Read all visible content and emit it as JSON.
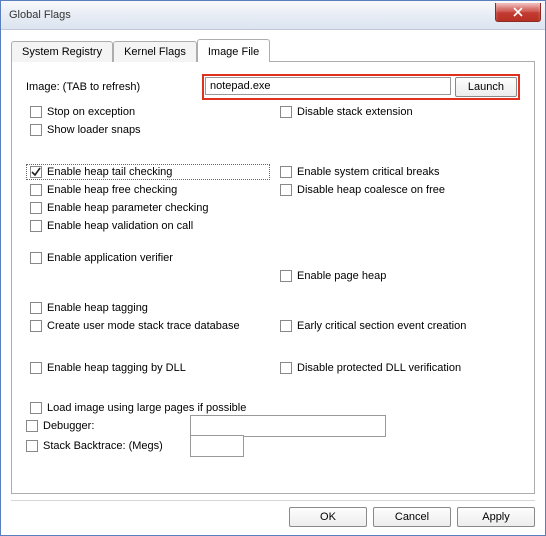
{
  "window": {
    "title": "Global Flags"
  },
  "tabs": {
    "items": [
      "System Registry",
      "Kernel Flags",
      "Image File"
    ],
    "active": 2
  },
  "image_row": {
    "label": "Image: (TAB to refresh)",
    "value": "notepad.exe",
    "launch": "Launch"
  },
  "left1": [
    {
      "label": "Stop on exception",
      "checked": false
    },
    {
      "label": "Show loader snaps",
      "checked": false
    }
  ],
  "right1": [
    {
      "label": "Disable stack extension",
      "checked": false
    }
  ],
  "left2": [
    {
      "label": "Enable heap tail checking",
      "checked": true,
      "focused": true
    },
    {
      "label": "Enable heap free checking",
      "checked": false
    },
    {
      "label": "Enable heap parameter checking",
      "checked": false
    },
    {
      "label": "Enable heap validation on call",
      "checked": false
    }
  ],
  "right2": [
    {
      "label": "Enable system critical breaks",
      "checked": false
    },
    {
      "label": "Disable heap coalesce on free",
      "checked": false
    }
  ],
  "left3": [
    {
      "label": "Enable application verifier",
      "checked": false
    }
  ],
  "right3": [
    {
      "label": "Enable page heap",
      "checked": false
    }
  ],
  "left4": [
    {
      "label": "Enable heap tagging",
      "checked": false
    },
    {
      "label": "Create user mode stack trace database",
      "checked": false
    }
  ],
  "right4": [
    {
      "label": "Early critical section event creation",
      "checked": false
    }
  ],
  "left5": [
    {
      "label": "Enable heap tagging by DLL",
      "checked": false
    }
  ],
  "right5": [
    {
      "label": "Disable protected DLL verification",
      "checked": false
    }
  ],
  "bottom": {
    "load_large": {
      "label": "Load image using large pages if possible",
      "checked": false
    },
    "debugger": {
      "label": "Debugger:",
      "checked": false,
      "value": ""
    },
    "backtrace": {
      "label": "Stack Backtrace: (Megs)",
      "checked": false,
      "value": ""
    }
  },
  "footer": {
    "ok": "OK",
    "cancel": "Cancel",
    "apply": "Apply"
  }
}
